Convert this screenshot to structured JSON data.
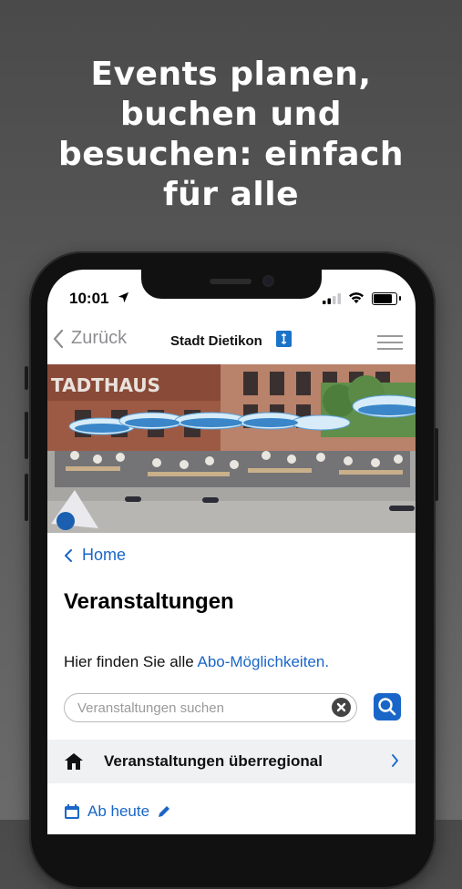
{
  "promo": {
    "headline_lines": [
      "Events planen,",
      "buchen und",
      "besuchen: einfach",
      "für alle"
    ]
  },
  "status_bar": {
    "time": "10:01"
  },
  "navbar": {
    "back_label": "Zurück",
    "title": "Stadt Dietikon"
  },
  "hero": {
    "building_sign": "TADTHAUS"
  },
  "page": {
    "breadcrumb": "Home",
    "title": "Veranstaltungen",
    "intro_text": "Hier finden Sie alle ",
    "intro_link": "Abo-Möglichkeiten.",
    "search_placeholder": "Veranstaltungen suchen",
    "category_row": "Veranstaltungen überregional",
    "date_filter": "Ab heute"
  },
  "colors": {
    "accent": "#1a66c8",
    "background": "#555555",
    "row_background": "#f0f1f3"
  },
  "icons": [
    "location-arrow-icon",
    "signal-icon",
    "wifi-icon",
    "battery-icon",
    "chevron-left-icon",
    "crest-icon",
    "hamburger-menu-icon",
    "clear-icon",
    "search-icon",
    "house-icon",
    "chevron-right-icon",
    "calendar-icon",
    "pencil-icon"
  ]
}
